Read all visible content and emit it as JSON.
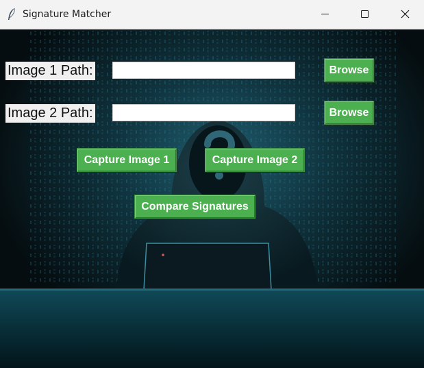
{
  "window": {
    "title": "Signature Matcher",
    "app_icon": "feather-icon",
    "controls": [
      "minimize-icon",
      "maximize-icon",
      "close-icon"
    ]
  },
  "form": {
    "image1_label": "Image 1 Path:",
    "image1_value": "",
    "image2_label": "Image 2 Path:",
    "image2_value": "",
    "browse1_label": "Browse",
    "browse2_label": "Browse"
  },
  "actions": {
    "capture1_label": "Capture Image 1",
    "capture2_label": "Capture Image 2",
    "compare_label": "Compare Signatures"
  },
  "colors": {
    "button_bg": "#4caf50",
    "button_text": "#ffffff",
    "label_bg": "#f0f0f0",
    "titlebar_bg": "#f3f3f3"
  }
}
